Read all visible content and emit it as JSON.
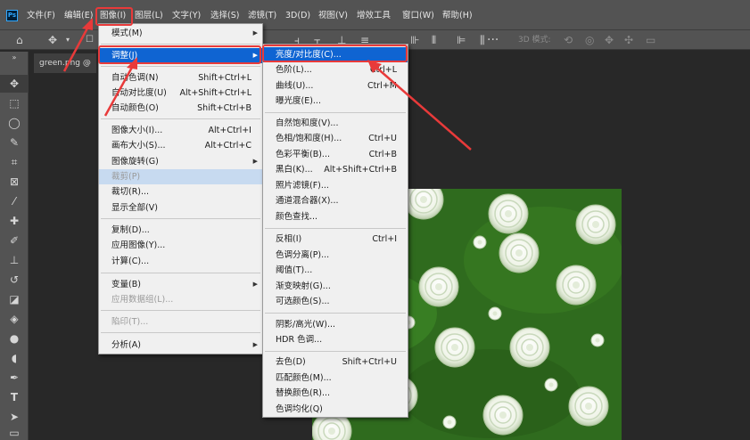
{
  "menubar": {
    "logo": "Ps",
    "items": [
      "文件(F)",
      "编辑(E)",
      "图像(I)",
      "图层(L)",
      "文字(Y)",
      "选择(S)",
      "滤镜(T)",
      "3D(D)",
      "视图(V)",
      "增效工具",
      "窗口(W)",
      "帮助(H)"
    ]
  },
  "optionsbar": {
    "mode_label": "3D 模式:"
  },
  "document": {
    "tab_title": "green.png @"
  },
  "image_menu": {
    "items": [
      {
        "label": "模式(M)",
        "shortcut": "",
        "submenu": true
      },
      {
        "label": "调整(J)",
        "shortcut": "",
        "submenu": true
      },
      {
        "label": "自动色调(N)",
        "shortcut": "Shift+Ctrl+L"
      },
      {
        "label": "自动对比度(U)",
        "shortcut": "Alt+Shift+Ctrl+L"
      },
      {
        "label": "自动颜色(O)",
        "shortcut": "Shift+Ctrl+B"
      },
      {
        "label": "图像大小(I)...",
        "shortcut": "Alt+Ctrl+I"
      },
      {
        "label": "画布大小(S)...",
        "shortcut": "Alt+Ctrl+C"
      },
      {
        "label": "图像旋转(G)",
        "shortcut": "",
        "submenu": true
      },
      {
        "label": "裁剪(P)",
        "shortcut": "",
        "disabled": true
      },
      {
        "label": "裁切(R)...",
        "shortcut": ""
      },
      {
        "label": "显示全部(V)",
        "shortcut": ""
      },
      {
        "label": "复制(D)...",
        "shortcut": ""
      },
      {
        "label": "应用图像(Y)...",
        "shortcut": ""
      },
      {
        "label": "计算(C)...",
        "shortcut": ""
      },
      {
        "label": "变量(B)",
        "shortcut": "",
        "submenu": true
      },
      {
        "label": "应用数据组(L)...",
        "shortcut": "",
        "disabled": true
      },
      {
        "label": "陷印(T)...",
        "shortcut": "",
        "disabled": true
      },
      {
        "label": "分析(A)",
        "shortcut": "",
        "submenu": true
      }
    ]
  },
  "adjust_menu": {
    "items": [
      {
        "label": "亮度/对比度(C)...",
        "shortcut": ""
      },
      {
        "label": "色阶(L)...",
        "shortcut": "Ctrl+L"
      },
      {
        "label": "曲线(U)...",
        "shortcut": "Ctrl+M"
      },
      {
        "label": "曝光度(E)...",
        "shortcut": ""
      },
      {
        "label": "自然饱和度(V)...",
        "shortcut": ""
      },
      {
        "label": "色相/饱和度(H)...",
        "shortcut": "Ctrl+U"
      },
      {
        "label": "色彩平衡(B)...",
        "shortcut": "Ctrl+B"
      },
      {
        "label": "黑白(K)...",
        "shortcut": "Alt+Shift+Ctrl+B"
      },
      {
        "label": "照片滤镜(F)...",
        "shortcut": ""
      },
      {
        "label": "通道混合器(X)...",
        "shortcut": ""
      },
      {
        "label": "颜色查找...",
        "shortcut": ""
      },
      {
        "label": "反相(I)",
        "shortcut": "Ctrl+I"
      },
      {
        "label": "色调分离(P)...",
        "shortcut": ""
      },
      {
        "label": "阈值(T)...",
        "shortcut": ""
      },
      {
        "label": "渐变映射(G)...",
        "shortcut": ""
      },
      {
        "label": "可选颜色(S)...",
        "shortcut": ""
      },
      {
        "label": "阴影/高光(W)...",
        "shortcut": ""
      },
      {
        "label": "HDR 色调...",
        "shortcut": ""
      },
      {
        "label": "去色(D)",
        "shortcut": "Shift+Ctrl+U"
      },
      {
        "label": "匹配颜色(M)...",
        "shortcut": ""
      },
      {
        "label": "替换颜色(R)...",
        "shortcut": ""
      },
      {
        "label": "色调均化(Q)",
        "shortcut": ""
      }
    ]
  },
  "colors": {
    "highlight_blue": "#0f64d2",
    "annotation_red": "#e83a3a",
    "canvas_green": "#2f6b1e"
  }
}
